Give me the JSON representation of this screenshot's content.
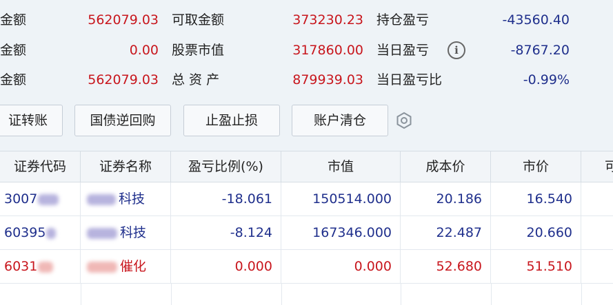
{
  "summary": {
    "row1": {
      "label_a": "金额",
      "value_a": "562079.03",
      "label_b": "可取金额",
      "value_b": "373230.23",
      "label_c": "持仓盈亏",
      "value_c": "-43560.40"
    },
    "row2": {
      "label_a": "金额",
      "value_a": "0.00",
      "label_b": "股票市值",
      "value_b": "317860.00",
      "label_c": "当日盈亏",
      "value_c": "-8767.20"
    },
    "row3": {
      "label_a": "金额",
      "value_a": "562079.03",
      "label_b": "总 资 产",
      "value_b": "879939.03",
      "label_c": "当日盈亏比",
      "value_c": "-0.99%"
    }
  },
  "info_icon_glyph": "i",
  "buttons": {
    "transfer": "证转账",
    "reverse_repo": "国债逆回购",
    "stop_profit_loss": "止盈止损",
    "clear_account": "账户清仓"
  },
  "table": {
    "headers": [
      "证券代码",
      "证券名称",
      "盈亏比例(%)",
      "市值",
      "成本价",
      "市价",
      "可"
    ],
    "rows": [
      {
        "code": "3007",
        "name": "科技",
        "ratio": "-18.061",
        "market_value": "150514.000",
        "cost": "20.186",
        "price": "16.540",
        "color": "blue"
      },
      {
        "code": "60395",
        "name": "科技",
        "ratio": "-8.124",
        "market_value": "167346.000",
        "cost": "22.487",
        "price": "20.660",
        "color": "blue"
      },
      {
        "code": "6031",
        "name": "催化",
        "ratio": "0.000",
        "market_value": "0.000",
        "cost": "52.680",
        "price": "51.510",
        "color": "red"
      }
    ]
  },
  "colors": {
    "loss": "#1f2f8c",
    "gain": "#c8161d"
  }
}
